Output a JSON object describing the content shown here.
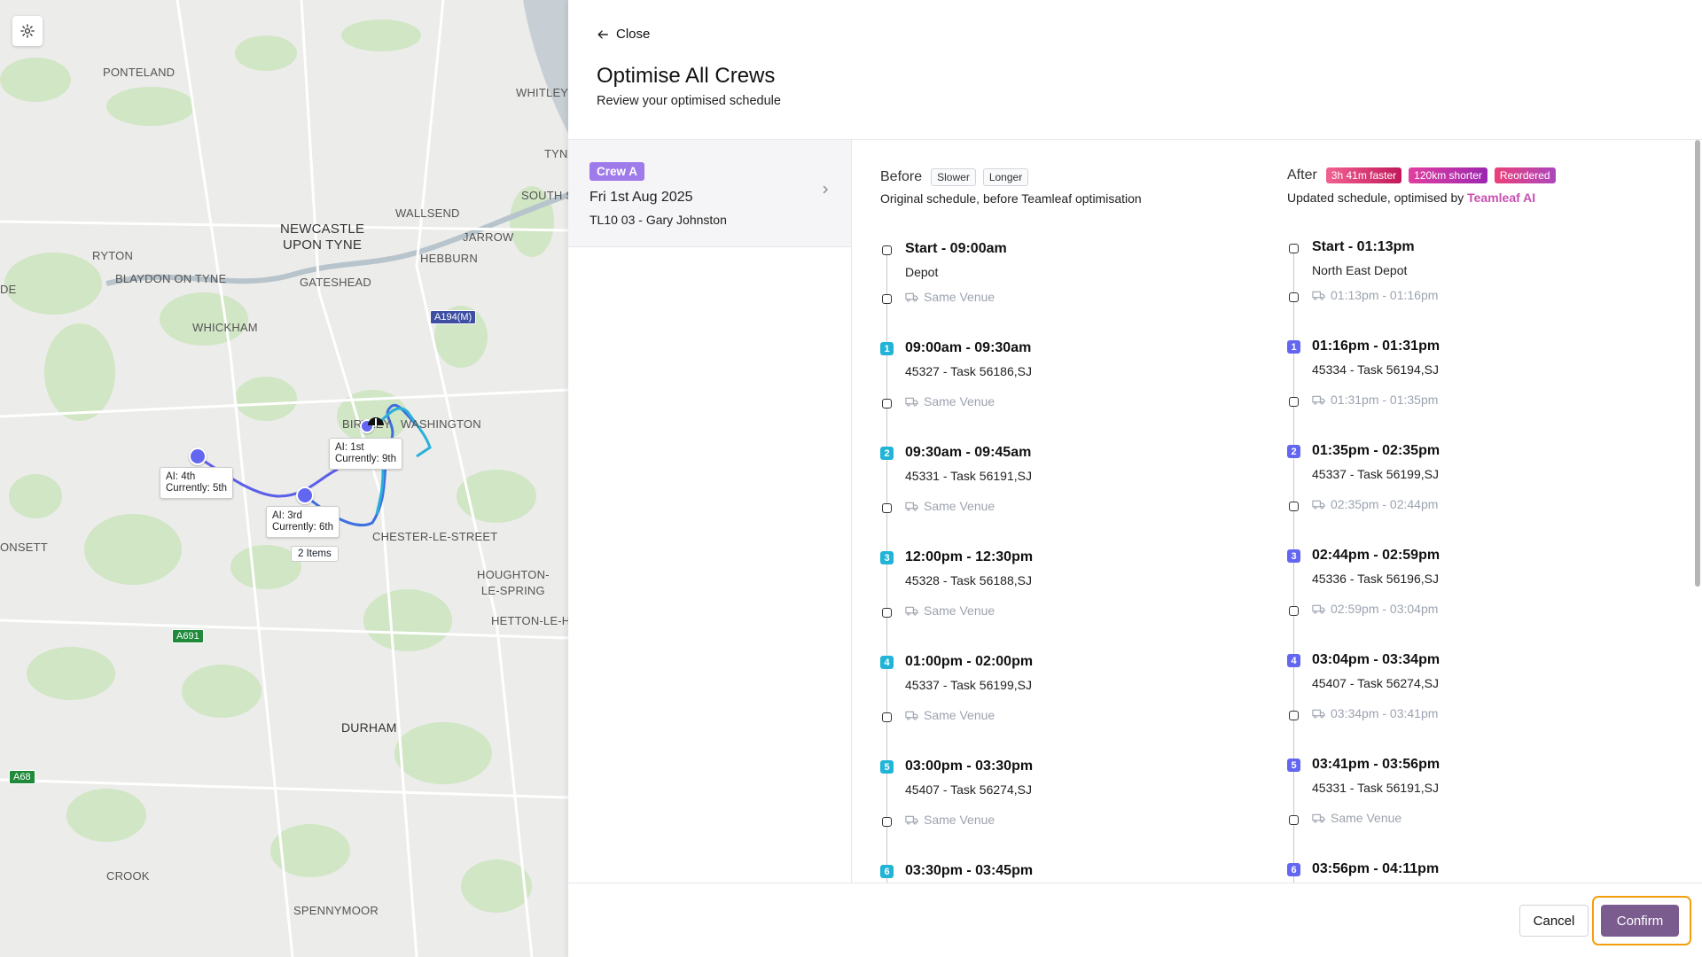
{
  "map": {
    "settings_icon": "gear-icon",
    "labels": [
      "PONTELAND",
      "WHITLEY",
      "TYN",
      "SOUTH S",
      "WALLSEND",
      "JARROW",
      "HEBBURN",
      "RYTON",
      "BLAYDON ON TYNE",
      "GATESHEAD",
      "WHICKHAM",
      "BIRTLEY",
      "WASHINGTON",
      "CHESTER-LE-STREET",
      "ONSETT",
      "HETTON-LE-HO",
      "DURHAM",
      "CROOK",
      "SPENNYMOOR",
      "DE"
    ],
    "big_labels": [
      "NEWCASTLE\nUPON TYNE",
      "HOUGHTON-\nLE-SPRING"
    ],
    "roads": [
      "A194(M)",
      "A691",
      "A68"
    ],
    "pins": [
      {
        "line1": "AI: 1st",
        "line2": "Currently: 9th"
      },
      {
        "line1": "AI: 4th",
        "line2": "Currently: 5th"
      },
      {
        "line1": "AI: 3rd",
        "line2": "Currently: 6th"
      }
    ],
    "items_chip": "2 Items"
  },
  "panel": {
    "close_label": "Close",
    "title": "Optimise All Crews",
    "subtitle": "Review your optimised schedule"
  },
  "crew": {
    "badge": "Crew A",
    "date": "Fri 1st Aug 2025",
    "name": "TL10 03 - Gary Johnston"
  },
  "before": {
    "heading": "Before",
    "tags": [
      "Slower",
      "Longer"
    ],
    "subtitle": "Original schedule, before Teamleaf optimisation",
    "start_time": "Start - 09:00am",
    "start_place": "Depot",
    "travel_label": "Same Venue",
    "jobs": [
      {
        "n": "1",
        "time": "09:00am - 09:30am",
        "desc": "45327 - Task 56186,SJ"
      },
      {
        "n": "2",
        "time": "09:30am - 09:45am",
        "desc": "45331 - Task 56191,SJ"
      },
      {
        "n": "3",
        "time": "12:00pm - 12:30pm",
        "desc": "45328 - Task 56188,SJ"
      },
      {
        "n": "4",
        "time": "01:00pm - 02:00pm",
        "desc": "45337 - Task 56199,SJ"
      },
      {
        "n": "5",
        "time": "03:00pm - 03:30pm",
        "desc": "45407 - Task 56274,SJ"
      },
      {
        "n": "6",
        "time": "03:30pm - 03:45pm",
        "desc": ""
      }
    ],
    "node_color": "#22b4d6"
  },
  "after": {
    "heading": "After",
    "tags": [
      {
        "label": "3h 41m faster",
        "from": "#f06292",
        "to": "#c2185b"
      },
      {
        "label": "120km shorter",
        "from": "#e040a0",
        "to": "#9c27b0"
      },
      {
        "label": "Reordered",
        "from": "#ec407a",
        "to": "#ab47bc"
      }
    ],
    "subtitle_prefix": "Updated schedule, optimised by ",
    "subtitle_brand": "Teamleaf AI",
    "start_time": "Start - 01:13pm",
    "start_place": "North East Depot",
    "travels": [
      "01:13pm  -  01:16pm",
      "01:31pm  -  01:35pm",
      "02:35pm  -  02:44pm",
      "02:59pm  -  03:04pm",
      "03:34pm  -  03:41pm",
      "Same Venue"
    ],
    "jobs": [
      {
        "n": "1",
        "time": "01:16pm - 01:31pm",
        "desc": "45334 - Task 56194,SJ"
      },
      {
        "n": "2",
        "time": "01:35pm - 02:35pm",
        "desc": "45337 - Task 56199,SJ"
      },
      {
        "n": "3",
        "time": "02:44pm - 02:59pm",
        "desc": "45336 - Task 56196,SJ"
      },
      {
        "n": "4",
        "time": "03:04pm - 03:34pm",
        "desc": "45407 - Task 56274,SJ"
      },
      {
        "n": "5",
        "time": "03:41pm - 03:56pm",
        "desc": "45331 - Task 56191,SJ"
      },
      {
        "n": "6",
        "time": "03:56pm - 04:11pm",
        "desc": ""
      }
    ],
    "node_color": "#6366f1"
  },
  "footer": {
    "cancel_label": "Cancel",
    "confirm_label": "Confirm"
  }
}
